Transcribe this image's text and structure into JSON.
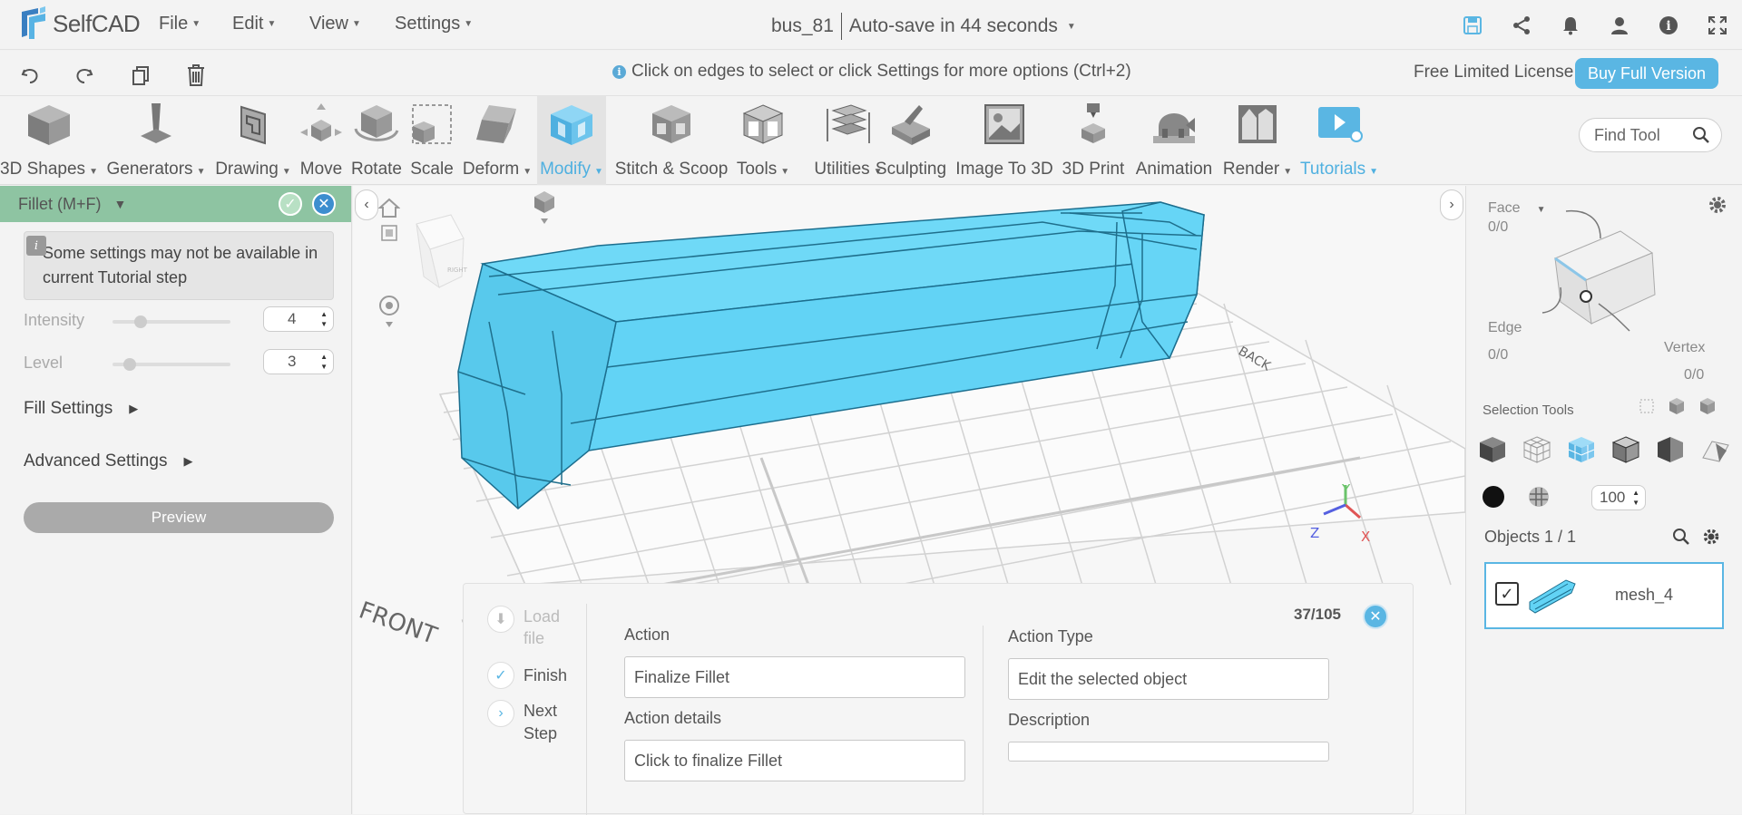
{
  "app": {
    "logo_text": "SelfCAD",
    "menus": [
      "File",
      "Edit",
      "View",
      "Settings"
    ],
    "file_name": "bus_81",
    "autosave": "Auto-save in 44 seconds"
  },
  "hintbar": {
    "hint": "Click on edges to select or click Settings for more options (Ctrl+2)",
    "license": "Free Limited License",
    "buy_label": "Buy Full Version"
  },
  "toolbar": {
    "tools": [
      {
        "label": "3D Shapes",
        "dropdown": true
      },
      {
        "label": "Generators",
        "dropdown": true
      },
      {
        "label": "Drawing",
        "dropdown": true
      },
      {
        "label": "Move",
        "dropdown": false
      },
      {
        "label": "Rotate",
        "dropdown": false
      },
      {
        "label": "Scale",
        "dropdown": false
      },
      {
        "label": "Deform",
        "dropdown": true
      },
      {
        "label": "Modify",
        "dropdown": true,
        "active": true
      },
      {
        "label": "Stitch & Scoop",
        "dropdown": false
      },
      {
        "label": "Tools",
        "dropdown": true
      },
      {
        "label": "Utilities",
        "dropdown": true
      },
      {
        "label": "Sculpting",
        "dropdown": false
      },
      {
        "label": "Image To 3D",
        "dropdown": false
      },
      {
        "label": "3D Print",
        "dropdown": false
      },
      {
        "label": "Animation",
        "dropdown": false
      },
      {
        "label": "Render",
        "dropdown": true
      },
      {
        "label": "Tutorials",
        "dropdown": true
      }
    ],
    "find_placeholder": "Find Tool"
  },
  "left_panel": {
    "title": "Fillet (M+F)",
    "notice": "Some settings may not be available in current Tutorial step",
    "intensity_label": "Intensity",
    "intensity_value": "4",
    "level_label": "Level",
    "level_value": "3",
    "fill_settings": "Fill Settings",
    "advanced_settings": "Advanced Settings",
    "preview_label": "Preview"
  },
  "viewport": {
    "front_label": "FRONT",
    "back_label": "BACK",
    "cube_labels": {
      "right": "RIGHT",
      "top": "TOP",
      "left": "LEFT"
    },
    "axes": {
      "x": "X",
      "y": "Y",
      "z": "Z"
    }
  },
  "tutorial": {
    "load_file": "Load file",
    "finish": "Finish",
    "next_step": "Next Step",
    "action_label": "Action",
    "action_value": "Finalize Fillet",
    "action_details_label": "Action details",
    "action_details_value": "Click to finalize Fillet",
    "action_type_label": "Action Type",
    "action_type_value": "Edit the selected object",
    "description_label": "Description",
    "description_value": "",
    "progress": "37/105"
  },
  "right_panel": {
    "face_label": "Face",
    "face_count": "0/0",
    "edge_label": "Edge",
    "edge_count": "0/0",
    "vertex_label": "Vertex",
    "vertex_count": "0/0",
    "selection_tools": "Selection Tools",
    "opacity_value": "100",
    "objects_label": "Objects 1 / 1",
    "object_name": "mesh_4"
  },
  "colors": {
    "accent": "#5ab6e3",
    "panel_header": "#8ec4a2",
    "mesh": "#62d3f5"
  }
}
